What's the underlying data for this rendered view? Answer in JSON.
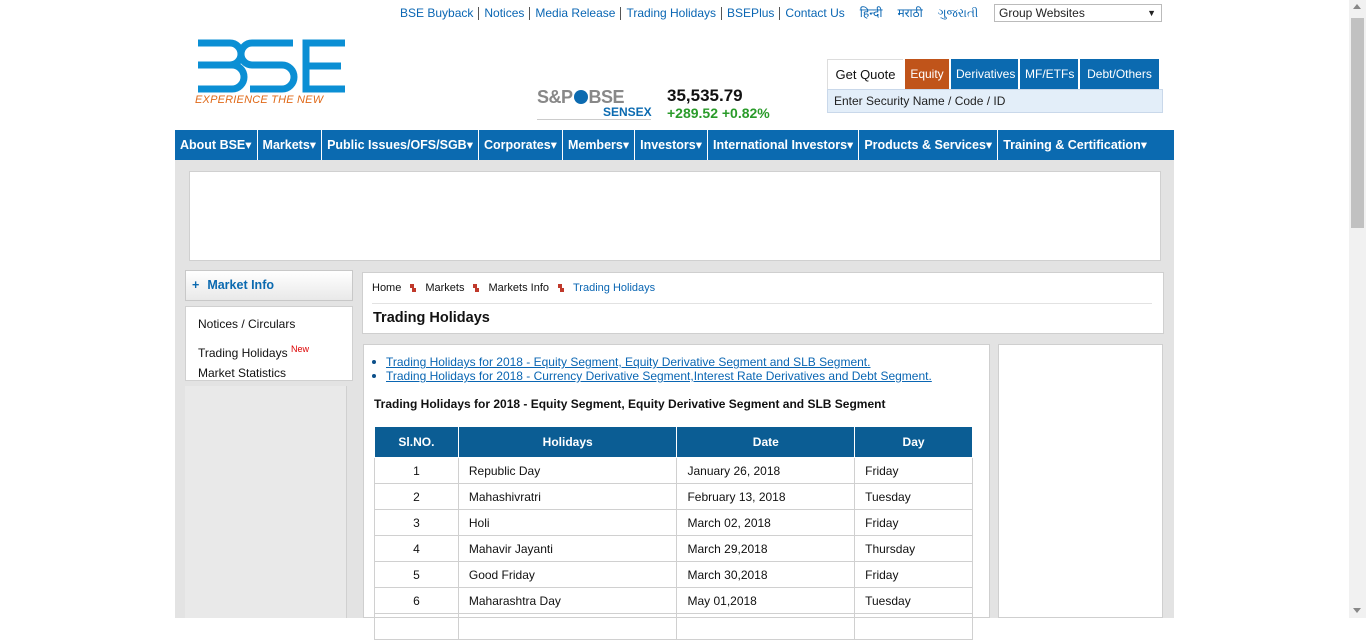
{
  "toplinks": [
    "BSE Buyback",
    "Notices",
    "Media Release",
    "Trading Holidays",
    "BSEPlus",
    "Contact Us"
  ],
  "languages": [
    "हिन्दी",
    "मराठी",
    "ગુજરાતી"
  ],
  "group_select": "Group Websites",
  "logo": {
    "text": "BSE",
    "tagline": "EXPERIENCE THE NEW"
  },
  "sensex": {
    "brand": "S&P",
    "brand2": "BSE",
    "sub": "SENSEX",
    "value": "35,535.79",
    "change": "+289.52 +0.82%"
  },
  "quote": {
    "tabs": [
      "Get Quote",
      "Equity",
      "Derivatives",
      "MF/ETFs",
      "Debt/Others"
    ],
    "placeholder": "Enter Security Name / Code / ID"
  },
  "nav": [
    "About BSE▾",
    "Markets▾",
    "Public Issues/OFS/SGB▾",
    "Corporates▾",
    "Members▾",
    "Investors▾",
    "International Investors▾",
    "Products & Services▾",
    "Training & Certification▾"
  ],
  "sidebar": {
    "heading": "Market Info",
    "items": [
      "Notices / Circulars",
      "Trading Holidays",
      "Market Statistics"
    ],
    "new_badge": "New"
  },
  "breadcrumb": [
    "Home",
    "Markets",
    "Markets Info",
    "Trading Holidays"
  ],
  "page_title": "Trading Holidays",
  "links": [
    "Trading Holidays for 2018 - Equity Segment, Equity Derivative Segment and SLB Segment.",
    "Trading Holidays for 2018 - Currency Derivative Segment,Interest Rate Derivatives and Debt Segment."
  ],
  "table_title": "Trading Holidays for 2018 - Equity Segment, Equity Derivative Segment and SLB Segment",
  "table": {
    "headers": [
      "Sl.NO.",
      "Holidays",
      "Date",
      "Day"
    ],
    "rows": [
      [
        "1",
        "Republic Day",
        "January 26, 2018",
        "Friday"
      ],
      [
        "2",
        "Mahashivratri",
        "February 13, 2018",
        "Tuesday"
      ],
      [
        "3",
        "Holi",
        "March 02, 2018",
        "Friday"
      ],
      [
        "4",
        "Mahavir Jayanti",
        "March 29,2018",
        "Thursday"
      ],
      [
        "5",
        "Good Friday",
        "March 30,2018",
        "Friday"
      ],
      [
        "6",
        "Maharashtra Day",
        "May 01,2018",
        "Tuesday"
      ]
    ]
  },
  "colors": {
    "brand_blue": "#0b6ab0",
    "accent_orange": "#c0541a",
    "sensex_green": "#2a9b2a"
  }
}
